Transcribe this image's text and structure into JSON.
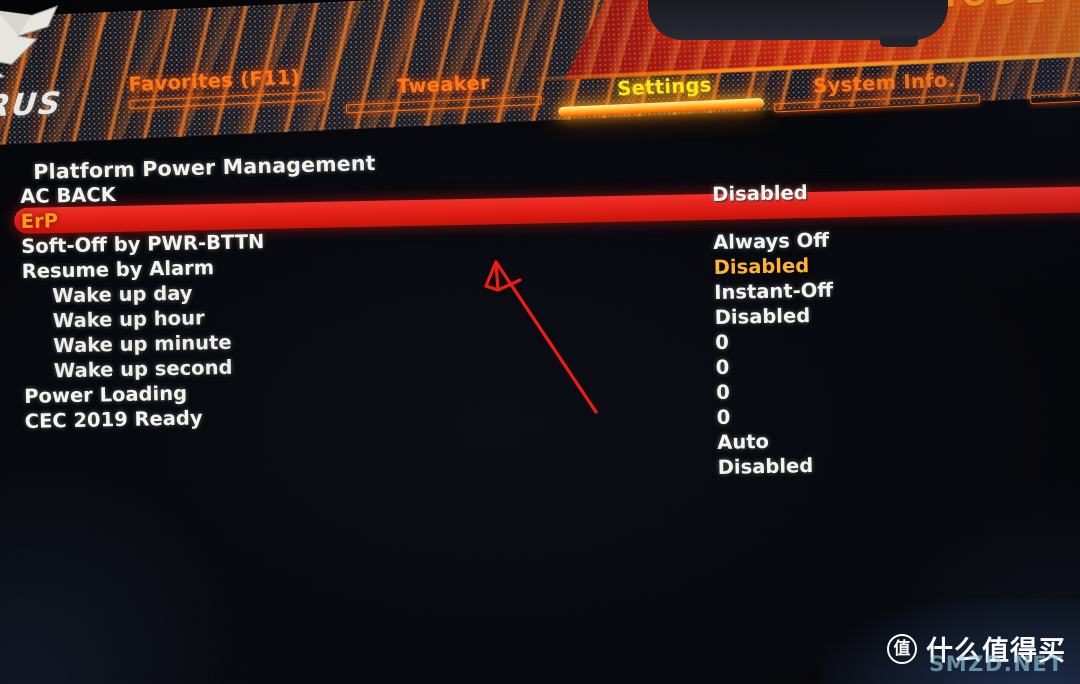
{
  "brand": {
    "logo_text": "ORUS",
    "falcon_icon": "aorus-falcon-icon"
  },
  "header": {
    "mode_title": "ADVANCED MODE",
    "tabs": [
      {
        "label": "Favorites (F11)",
        "active": false
      },
      {
        "label": "Tweaker",
        "active": false
      },
      {
        "label": "Settings",
        "active": true
      },
      {
        "label": "System Info.",
        "active": false
      }
    ]
  },
  "page": {
    "section_title": "Platform Power Management"
  },
  "settings": {
    "rows": [
      {
        "label": "AC BACK",
        "value": "Disabled",
        "indent": false,
        "selected": false
      },
      {
        "label": "ErP",
        "value": "Always Off",
        "indent": false,
        "selected": false
      },
      {
        "label": "Soft-Off by PWR-BTTN",
        "value": "Disabled",
        "indent": false,
        "selected": true
      },
      {
        "label": "Resume by Alarm",
        "value": "Instant-Off",
        "indent": false,
        "selected": false
      },
      {
        "label": "Wake up day",
        "value": "Disabled",
        "indent": true,
        "selected": false
      },
      {
        "label": "Wake up hour",
        "value": "0",
        "indent": true,
        "selected": false
      },
      {
        "label": "Wake up minute",
        "value": "0",
        "indent": true,
        "selected": false
      },
      {
        "label": "Wake up second",
        "value": "0",
        "indent": true,
        "selected": false
      },
      {
        "label": "Power Loading",
        "value": "0",
        "indent": false,
        "selected": false
      },
      {
        "label": "CEC 2019 Ready",
        "value": "Auto",
        "indent": false,
        "selected": false
      },
      {
        "label": "",
        "value": "Disabled",
        "indent": false,
        "selected": false
      }
    ],
    "selected_row_label": "ErP",
    "selected_row_value": "Disabled"
  },
  "annotation": {
    "type": "arrow",
    "note": "red outlined arrow pointing to the ErP highlighted row"
  },
  "watermark": {
    "logo_glyph": "值",
    "text": "什么值得买",
    "ghost_text": "SMZD.NET"
  },
  "colors": {
    "accent_orange": "#ff7a16",
    "accent_yellow": "#ffe817",
    "selection_red": "#e42018",
    "selected_text": "#ff9c1e",
    "text_white": "#f4f4f1",
    "background": "#07080d",
    "annotation_red": "#f01a14"
  }
}
